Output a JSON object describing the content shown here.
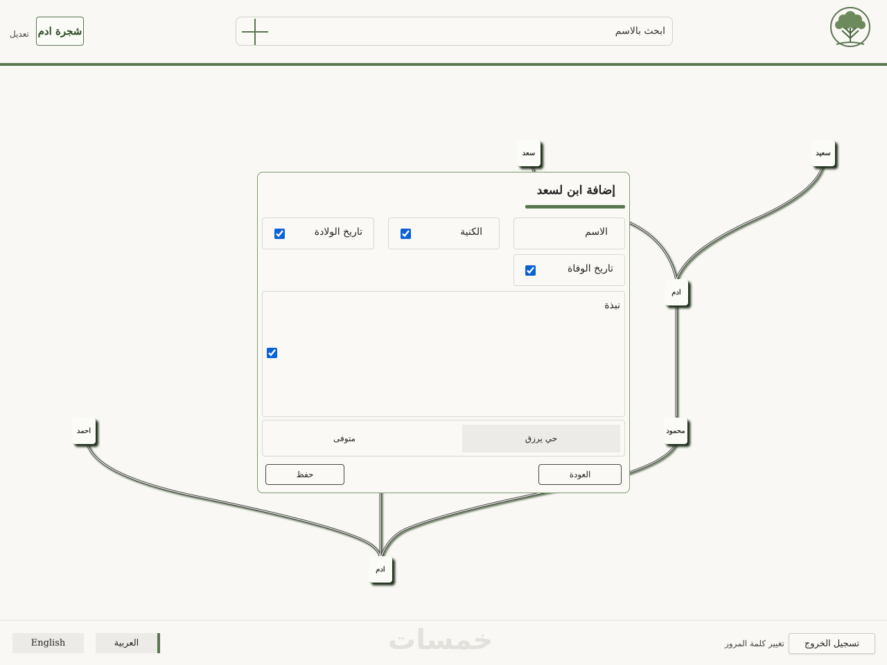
{
  "header": {
    "search_placeholder": "ابحث بالاسم",
    "tree_title": "شجرة ادم",
    "edit_label": "تعديل"
  },
  "tree": {
    "nodes": {
      "saad": "سعد",
      "saeed": "سعيد",
      "adam_mid": "ادم",
      "mahmoud": "محمود",
      "ahmed": "احمد",
      "adam_root": "ادم"
    }
  },
  "dialog": {
    "title": "إضافة ابن لسعد",
    "fields": {
      "name": "الاسم",
      "kunya": "الكنية",
      "birth_date": "تاريخ الولادة",
      "death_date": "تاريخ الوفاة",
      "bio": "نبذة"
    },
    "checked": {
      "kunya": true,
      "birth_date": true,
      "death_date": true,
      "bio": true
    },
    "status_options": {
      "alive": "حي يرزق",
      "deceased": "متوفى"
    },
    "status_selected": "alive",
    "back_label": "العودة",
    "save_label": "حفظ"
  },
  "footer": {
    "lang_english": "English",
    "lang_arabic": "العربية",
    "watermark": "خمسات",
    "change_password": "تغيير كلمة المرور",
    "logout": "تسجيل الخروج"
  },
  "colors": {
    "accent": "#5a7550",
    "checkbox": "#0b62d6",
    "background": "#f9f8f5"
  }
}
